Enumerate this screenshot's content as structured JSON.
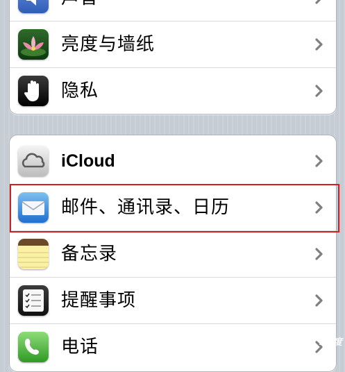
{
  "settings": {
    "group1": [
      {
        "label": "声音",
        "icon": "sound-icon"
      },
      {
        "label": "亮度与墙纸",
        "icon": "brightness-wallpaper-icon"
      },
      {
        "label": "隐私",
        "icon": "privacy-hand-icon"
      }
    ],
    "group2": [
      {
        "label": "iCloud",
        "icon": "icloud-icon"
      },
      {
        "label": "邮件、通讯录、日历",
        "icon": "mail-icon"
      },
      {
        "label": "备忘录",
        "icon": "notes-icon"
      },
      {
        "label": "提醒事项",
        "icon": "reminders-icon"
      },
      {
        "label": "电话",
        "icon": "phone-icon"
      }
    ]
  },
  "watermark": "Bai度"
}
